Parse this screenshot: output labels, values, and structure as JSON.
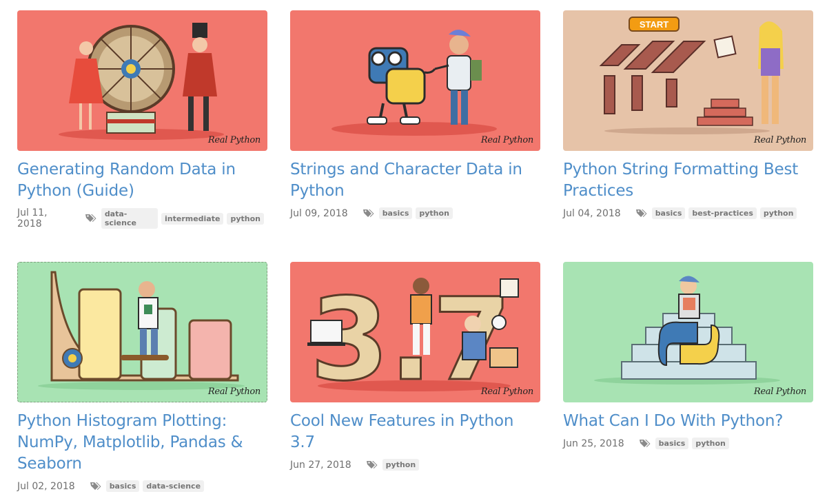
{
  "brand_logo_text": "Real Python",
  "articles": [
    {
      "title": "Generating Random Data in Python (Guide)",
      "date": "Jul 11, 2018",
      "tags": [
        "data-science",
        "intermediate",
        "python"
      ],
      "thumbnail_bg": "#f2776d"
    },
    {
      "title": "Strings and Character Data in Python",
      "date": "Jul 09, 2018",
      "tags": [
        "basics",
        "python"
      ],
      "thumbnail_bg": "#f2776d"
    },
    {
      "title": "Python String Formatting Best Practices",
      "date": "Jul 04, 2018",
      "tags": [
        "basics",
        "best-practices",
        "python"
      ],
      "thumbnail_bg": "#e6c3a8"
    },
    {
      "title": "Python Histogram Plotting: NumPy, Matplotlib, Pandas & Seaborn",
      "date": "Jul 02, 2018",
      "tags": [
        "basics",
        "data-science"
      ],
      "thumbnail_bg": "#a8e3b3"
    },
    {
      "title": "Cool New Features in Python 3.7",
      "date": "Jun 27, 2018",
      "tags": [
        "python"
      ],
      "thumbnail_bg": "#f2776d"
    },
    {
      "title": "What Can I Do With Python?",
      "date": "Jun 25, 2018",
      "tags": [
        "basics",
        "python"
      ],
      "thumbnail_bg": "#a8e3b3"
    }
  ],
  "illustration_text": {
    "start_sign": "START",
    "big_number": "3.7"
  },
  "colors": {
    "title_link": "#4f8ec9",
    "tag_bg": "#f0f0f0",
    "meta_text": "#6f6f6f"
  }
}
